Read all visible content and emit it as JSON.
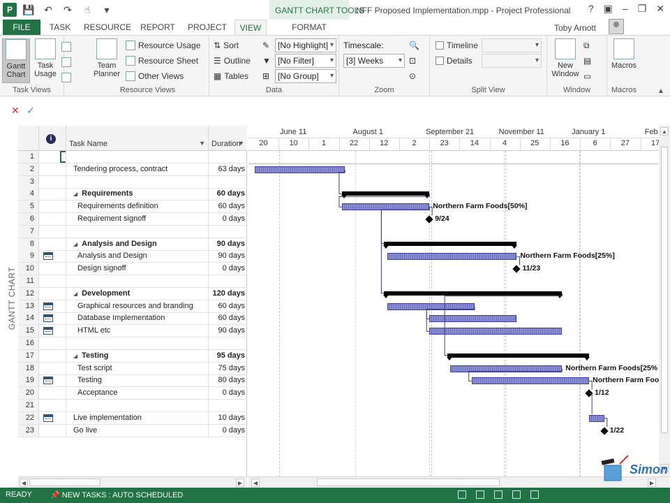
{
  "window": {
    "app_icon": "P",
    "title": "NFF Proposed Implementation.mpp - Project Professional",
    "contextual_group": "GANTT CHART TOOLS",
    "help": "?",
    "minimize": "–",
    "restore": "❐",
    "close": "✕"
  },
  "qat": {
    "save": "💾",
    "undo": "↶",
    "redo": "↷"
  },
  "tabs": {
    "file": "FILE",
    "task": "TASK",
    "resource": "RESOURCE",
    "report": "REPORT",
    "project": "PROJECT",
    "view": "VIEW",
    "format": "FORMAT"
  },
  "user": {
    "name": "Toby Arnott"
  },
  "ribbon": {
    "task_views": {
      "label": "Task Views",
      "gantt_chart": "Gantt Chart",
      "task_usage": "Task Usage"
    },
    "resource_views": {
      "label": "Resource Views",
      "team_planner": "Team Planner",
      "resource_usage": "Resource Usage",
      "resource_sheet": "Resource Sheet",
      "other_views": "Other Views"
    },
    "data": {
      "label": "Data",
      "sort": "Sort",
      "outline": "Outline",
      "tables": "Tables",
      "highlight": "[No Highlight]",
      "filter": "[No Filter]",
      "group": "[No Group]"
    },
    "zoom": {
      "label": "Zoom",
      "timescale_label": "Timescale:",
      "timescale_value": "[3] Weeks"
    },
    "split_view": {
      "label": "Split View",
      "timeline": "Timeline",
      "details": "Details"
    },
    "window": {
      "label": "Window",
      "new_window": "New Window"
    },
    "macros": {
      "label": "Macros",
      "macros": "Macros"
    }
  },
  "view_bar_label": "GANTT CHART",
  "grid": {
    "columns": {
      "task_name": "Task Name",
      "duration": "Duration"
    },
    "rows": [
      {
        "id": "1",
        "name": "",
        "duration": "",
        "summary": false,
        "level": 0,
        "icon": false
      },
      {
        "id": "2",
        "name": "Tendering process, contract",
        "duration": "63 days",
        "summary": false,
        "level": 0,
        "icon": false
      },
      {
        "id": "3",
        "name": "",
        "duration": "",
        "summary": false,
        "level": 0,
        "icon": false
      },
      {
        "id": "4",
        "name": "Requirements",
        "duration": "60 days",
        "summary": true,
        "level": 0,
        "icon": false
      },
      {
        "id": "5",
        "name": "Requirements definition",
        "duration": "60 days",
        "summary": false,
        "level": 1,
        "icon": false
      },
      {
        "id": "6",
        "name": "Requirement signoff",
        "duration": "0 days",
        "summary": false,
        "level": 1,
        "icon": false
      },
      {
        "id": "7",
        "name": "",
        "duration": "",
        "summary": false,
        "level": 0,
        "icon": false
      },
      {
        "id": "8",
        "name": "Analysis and Design",
        "duration": "90 days",
        "summary": true,
        "level": 0,
        "icon": false
      },
      {
        "id": "9",
        "name": "Analysis and Design",
        "duration": "90 days",
        "summary": false,
        "level": 1,
        "icon": true
      },
      {
        "id": "10",
        "name": "Design signoff",
        "duration": "0 days",
        "summary": false,
        "level": 1,
        "icon": false
      },
      {
        "id": "11",
        "name": "",
        "duration": "",
        "summary": false,
        "level": 0,
        "icon": false
      },
      {
        "id": "12",
        "name": "Development",
        "duration": "120 days",
        "summary": true,
        "level": 0,
        "icon": false
      },
      {
        "id": "13",
        "name": "Graphical resources and branding",
        "duration": "60 days",
        "summary": false,
        "level": 1,
        "icon": true
      },
      {
        "id": "14",
        "name": "Database Implementation",
        "duration": "60 days",
        "summary": false,
        "level": 1,
        "icon": true
      },
      {
        "id": "15",
        "name": "HTML etc",
        "duration": "90 days",
        "summary": false,
        "level": 1,
        "icon": true
      },
      {
        "id": "16",
        "name": "",
        "duration": "",
        "summary": false,
        "level": 0,
        "icon": false
      },
      {
        "id": "17",
        "name": "Testing",
        "duration": "95 days",
        "summary": true,
        "level": 0,
        "icon": false
      },
      {
        "id": "18",
        "name": "Test script",
        "duration": "75 days",
        "summary": false,
        "level": 1,
        "icon": false
      },
      {
        "id": "19",
        "name": "Testing",
        "duration": "80 days",
        "summary": false,
        "level": 1,
        "icon": true
      },
      {
        "id": "20",
        "name": "Acceptance",
        "duration": "0 days",
        "summary": false,
        "level": 1,
        "icon": false
      },
      {
        "id": "21",
        "name": "",
        "duration": "",
        "summary": false,
        "level": 0,
        "icon": false
      },
      {
        "id": "22",
        "name": "Live implementation",
        "duration": "10 days",
        "summary": false,
        "level": 0,
        "icon": true
      },
      {
        "id": "23",
        "name": "Go live",
        "duration": "0 days",
        "summary": false,
        "level": 0,
        "icon": false
      }
    ]
  },
  "timescale": {
    "top_tier": [
      "June 11",
      "August 1",
      "September 21",
      "November 11",
      "January 1",
      "Feb"
    ],
    "bottom_tier": [
      "20",
      "10",
      "1",
      "22",
      "12",
      "2",
      "23",
      "14",
      "4",
      "25",
      "16",
      "6",
      "27",
      "17"
    ]
  },
  "gantt": {
    "bars": [
      {
        "row": 2,
        "type": "task",
        "start_col": 0.2,
        "end_col": 3.2
      },
      {
        "row": 4,
        "type": "summary",
        "start_col": 3.1,
        "end_col": 6.0
      },
      {
        "row": 5,
        "type": "task",
        "start_col": 3.1,
        "end_col": 6.0,
        "label": "Northern Farm Foods[50%]"
      },
      {
        "row": 6,
        "type": "milestone",
        "at_col": 6.0,
        "label": "9/24"
      },
      {
        "row": 8,
        "type": "summary",
        "start_col": 4.5,
        "end_col": 8.9
      },
      {
        "row": 9,
        "type": "task",
        "start_col": 4.6,
        "end_col": 8.9,
        "label": "Northern Farm Foods[25%]"
      },
      {
        "row": 10,
        "type": "milestone",
        "at_col": 8.9,
        "label": "11/23"
      },
      {
        "row": 12,
        "type": "summary",
        "start_col": 4.5,
        "end_col": 10.4
      },
      {
        "row": 13,
        "type": "task",
        "start_col": 4.6,
        "end_col": 7.5
      },
      {
        "row": 14,
        "type": "task",
        "start_col": 6.0,
        "end_col": 8.9
      },
      {
        "row": 15,
        "type": "task",
        "start_col": 6.0,
        "end_col": 10.4
      },
      {
        "row": 17,
        "type": "summary",
        "start_col": 6.6,
        "end_col": 11.3
      },
      {
        "row": 18,
        "type": "task",
        "start_col": 6.7,
        "end_col": 10.4,
        "label": "Northern Farm Foods[25%"
      },
      {
        "row": 19,
        "type": "task",
        "start_col": 7.4,
        "end_col": 11.3,
        "label": "Northern Farm Foo"
      },
      {
        "row": 20,
        "type": "milestone",
        "at_col": 11.3,
        "label": "1/12"
      },
      {
        "row": 22,
        "type": "task",
        "start_col": 11.3,
        "end_col": 11.8
      },
      {
        "row": 23,
        "type": "milestone",
        "at_col": 11.8,
        "label": "1/22"
      }
    ],
    "links": [
      [
        2,
        4
      ],
      [
        4,
        5
      ],
      [
        5,
        6
      ],
      [
        5,
        8
      ],
      [
        5,
        12
      ],
      [
        9,
        10
      ],
      [
        13,
        14
      ],
      [
        13,
        15
      ],
      [
        12,
        17
      ],
      [
        18,
        19
      ],
      [
        19,
        20
      ],
      [
        20,
        22
      ],
      [
        22,
        23
      ]
    ]
  },
  "status": {
    "ready": "READY",
    "new_tasks": "NEW TASKS : AUTO SCHEDULED"
  },
  "logo_text": "Simon"
}
